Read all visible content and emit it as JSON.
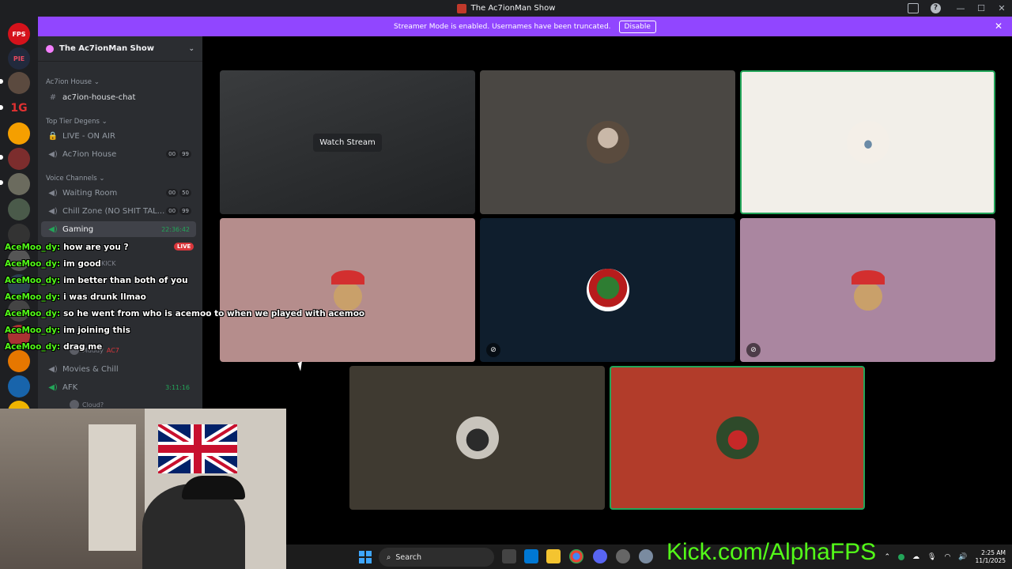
{
  "window": {
    "title": "The Ac7ionMan Show",
    "controls": [
      "—",
      "☐",
      "✕"
    ]
  },
  "banner": {
    "text": "Streamer Mode is enabled. Usernames have been truncated.",
    "button": "Disable"
  },
  "sidebar": {
    "server_name": "The Ac7ionMan Show",
    "categories": {
      "house": "Ac7ion House",
      "top": "Top Tier Degens",
      "voice": "Voice Channels"
    },
    "channels": {
      "house_chat": "ac7ion-house-chat",
      "live_on_air": "LIVE - ON AIR",
      "ac7ion_house": "Ac7ion House",
      "ac7ion_house_counts": [
        "00",
        "99"
      ],
      "waiting_room": "Waiting Room",
      "waiting_room_counts": [
        "00",
        "50"
      ],
      "chill_zone": "Chill Zone (NO SHIT TAL...",
      "chill_zone_counts": [
        "00",
        "99"
      ],
      "gaming": "Gaming",
      "gaming_timer": "22:36:42",
      "live_badge": "LIVE",
      "movies": "Movies & Chill",
      "afk": "AFK",
      "afk_timer": "3:11:16"
    },
    "users": {
      "kick_tag": "KICK",
      "muddy": "Muddy",
      "ac7": "AC7",
      "cloud": "Cloud?"
    }
  },
  "stage": {
    "watch_stream": "Watch Stream"
  },
  "chat": [
    {
      "name": "AceMoo_dy:",
      "msg": "how are you ?"
    },
    {
      "name": "AceMoo_dy:",
      "msg": "im good"
    },
    {
      "name": "AceMoo_dy:",
      "msg": "im better than both of you"
    },
    {
      "name": "AceMoo_dy:",
      "msg": "i was drunk llmao"
    },
    {
      "name": "AceMoo_dy:",
      "msg": "so he went from who is acemoo to when we played with acemoo"
    },
    {
      "name": "AceMoo_dy:",
      "msg": "im joining this"
    },
    {
      "name": "AceMoo_dy:",
      "msg": "drag me"
    }
  ],
  "taskbar": {
    "search": "Search",
    "overlay_text": "Kick.com/AlphaFPS",
    "time": "2:25 AM",
    "date": "11/1/2025"
  },
  "colors": {
    "accent": "#9146ff",
    "kick_green": "#53fc18",
    "speaking_border": "#23a559"
  }
}
